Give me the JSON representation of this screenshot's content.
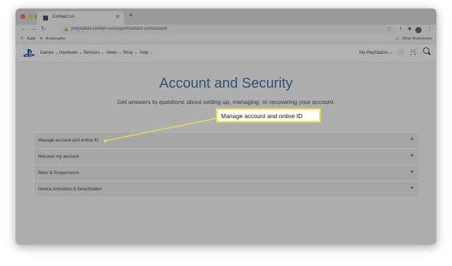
{
  "browser": {
    "tab_title": "Contact us",
    "url": "playstation.com/en-us/support/contact-us/#account",
    "bookmarks": [
      "Apps",
      "Bookmarks"
    ],
    "other_bookmarks": "Other Bookmarks"
  },
  "site_nav": {
    "items": [
      "Games",
      "Hardware",
      "Services",
      "News",
      "Shop",
      "Help"
    ],
    "my_playstation": "My PlayStation"
  },
  "main": {
    "heading": "Account and Security",
    "subtitle": "Get answers to questions about setting up, managing, or recovering your account.",
    "faq": [
      "Manage account and online ID",
      "Recover my account",
      "Bans & Suspensions",
      "Device Activation & Deactivation"
    ]
  },
  "callout": {
    "text": "Manage account and online ID",
    "border_color": "#f3e23a"
  },
  "colors": {
    "heading": "#1f5a9e",
    "ps_logo": "#003791"
  }
}
